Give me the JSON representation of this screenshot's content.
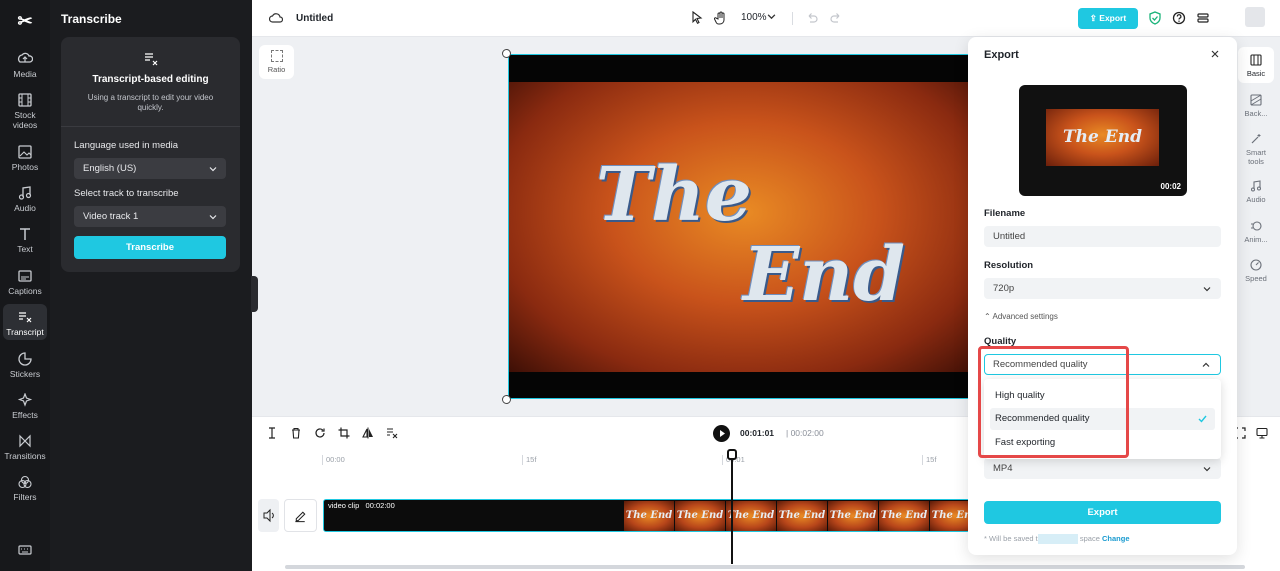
{
  "left_rail": {
    "items": [
      {
        "label": "Media",
        "icon": "media-icon"
      },
      {
        "label": "Stock videos",
        "icon": "film-icon"
      },
      {
        "label": "Photos",
        "icon": "image-icon"
      },
      {
        "label": "Audio",
        "icon": "music-note-icon"
      },
      {
        "label": "Text",
        "icon": "text-icon"
      },
      {
        "label": "Captions",
        "icon": "captions-icon"
      },
      {
        "label": "Transcript",
        "icon": "transcript-icon",
        "active": true
      },
      {
        "label": "Stickers",
        "icon": "sticker-icon"
      },
      {
        "label": "Effects",
        "icon": "sparkle-icon"
      },
      {
        "label": "Transitions",
        "icon": "bowtie-icon"
      },
      {
        "label": "Filters",
        "icon": "filters-icon"
      }
    ]
  },
  "transcribe_panel": {
    "title": "Transcribe",
    "card_title": "Transcript-based editing",
    "card_desc": "Using a transcript to edit your video quickly.",
    "language_label": "Language used in media",
    "language_value": "English (US)",
    "track_label": "Select track to transcribe",
    "track_value": "Video track 1",
    "button": "Transcribe"
  },
  "topbar": {
    "project_name": "Untitled",
    "zoom": "100%",
    "export_label": "Export"
  },
  "canvas": {
    "ratio_label": "Ratio",
    "video_text_line1": "The",
    "video_text_line2": "End"
  },
  "timeline": {
    "current_time": "00:01:01",
    "total_time": "00:02:00",
    "ruler": [
      "00:00",
      "15f",
      "00:01",
      "15f"
    ],
    "clip_label": "video clip",
    "clip_duration": "00:02:00",
    "thumb_text": "The End"
  },
  "right_rail": {
    "items": [
      {
        "label": "Basic",
        "active": true
      },
      {
        "label": "Back..."
      },
      {
        "label": "Smart tools"
      },
      {
        "label": "Audio"
      },
      {
        "label": "Anim..."
      },
      {
        "label": "Speed"
      }
    ]
  },
  "export_dialog": {
    "title": "Export",
    "preview_duration": "00:02",
    "preview_text": "The End",
    "filename_label": "Filename",
    "filename_value": "Untitled",
    "resolution_label": "Resolution",
    "resolution_value": "720p",
    "advanced_label": "Advanced settings",
    "quality_label": "Quality",
    "quality_value": "Recommended quality",
    "quality_options": [
      "High quality",
      "Recommended quality",
      "Fast exporting"
    ],
    "format_value": "MP4",
    "export_button": "Export",
    "note_prefix": "* Will be saved t",
    "note_suffix": "space",
    "note_link": "Change"
  },
  "colors": {
    "accent": "#1fc8e1",
    "highlight": "#e54848"
  }
}
